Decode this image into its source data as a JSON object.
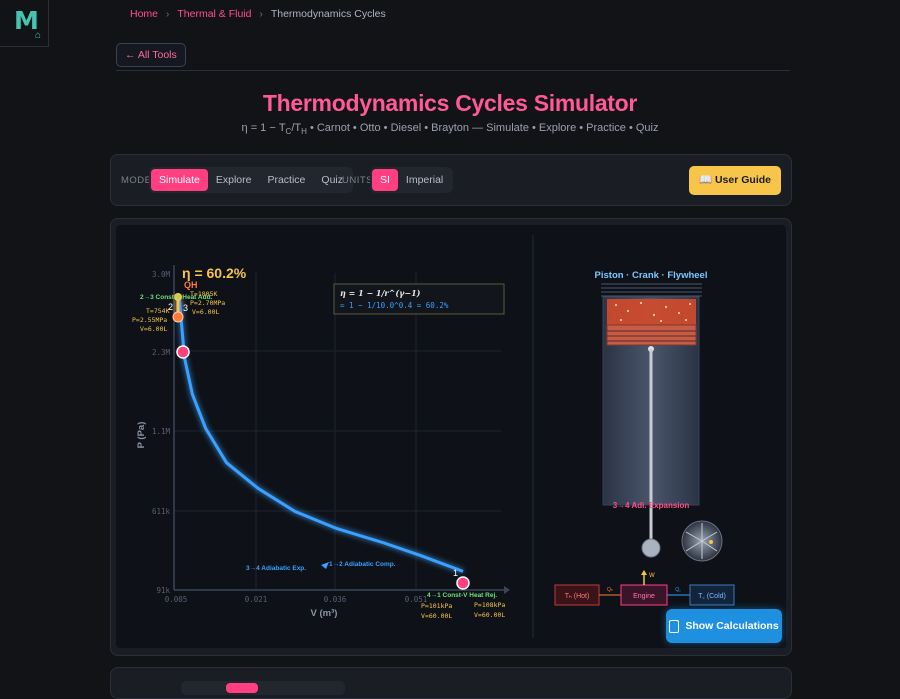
{
  "logo": {
    "letter": "M",
    "home_icon": "home-icon"
  },
  "breadcrumb": {
    "home": "Home",
    "category": "Thermal & Fluid",
    "current": "Thermodynamics Cycles"
  },
  "nav": {
    "all_tools": "← All Tools"
  },
  "header": {
    "title": "Thermodynamics Cycles Simulator",
    "subtitle": "η = 1 − TC/TH • Carnot • Otto • Diesel • Brayton — Simulate • Explore • Practice • Quiz"
  },
  "toolbar": {
    "mode_label": "MODE",
    "modes": [
      "Simulate",
      "Explore",
      "Practice",
      "Quiz"
    ],
    "active_mode": "Simulate",
    "units_label": "UNITS",
    "units": [
      "SI",
      "Imperial"
    ],
    "active_unit": "SI",
    "guide_label": "📖 User Guide"
  },
  "chart_data": {
    "type": "line",
    "title": "η = 60.2%",
    "xlabel": "V (m³)",
    "ylabel": "P (Pa)",
    "x_ticks": [
      "0.005",
      "0.021",
      "0.036",
      "0.051"
    ],
    "y_ticks": [
      "91k",
      "611k",
      "1.1M",
      "2.3M",
      "3.0M"
    ],
    "formula_line1": "η = 1 − 1/r^(γ−1)",
    "formula_line2": "= 1 − 1/10.0^0.4 = 60.2%",
    "state_labels": [
      "1",
      "2",
      "3",
      "4"
    ],
    "process_labels": {
      "compression": "1→2 Adiabatic Comp.",
      "heat_add": "2→3 Const-V Heat Add.",
      "expansion": "3→4 Adiabatic Exp.",
      "heat_rej": "4→1 Const-V Heat Rej."
    },
    "qh_label": "QH",
    "annotations": {
      "state2": [
        "T=754K",
        "P=2.55MPa",
        "V=6.00L"
      ],
      "state3": [
        "T=1805K",
        "P=2.70MPa",
        "V=6.00L"
      ],
      "state1": [
        "T=300K",
        "P=101kPa",
        "V=60.00L"
      ],
      "state4": [
        "T=...",
        "P=108kPa",
        "V=60.00L"
      ]
    },
    "curve_points_V_P": [
      [
        0.006,
        2550000
      ],
      [
        0.007,
        1650000
      ],
      [
        0.0085,
        1200000
      ],
      [
        0.011,
        850000
      ],
      [
        0.015,
        560000
      ],
      [
        0.021,
        390000
      ],
      [
        0.028,
        270000
      ],
      [
        0.036,
        200000
      ],
      [
        0.045,
        155000
      ],
      [
        0.052,
        125000
      ],
      [
        0.06,
        101000
      ]
    ],
    "grid": true
  },
  "animation": {
    "title": "Piston · Crank · Flywheel",
    "stage_label": "3→4 Adi. Expansion",
    "hot_label": "Tₕ (Hot)",
    "engine_label": "Engine",
    "cold_label": "T꜀ (Cold)",
    "qh": "Qₕ",
    "qc": "Q꜀",
    "w": "W"
  },
  "calc_button": {
    "label": "Show Calculations"
  },
  "colors": {
    "accent": "#ff3f7f",
    "curve": "#3aa0ff",
    "guide": "#f6c54a",
    "title": "#ff5a93"
  }
}
